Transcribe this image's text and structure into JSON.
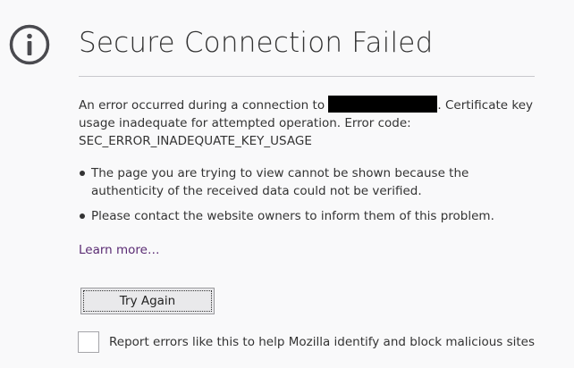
{
  "page": {
    "title": "Secure Connection Failed",
    "icon": "info-icon"
  },
  "description": {
    "before_host": "An error occurred during a connection to ",
    "after_host": ". Certificate key usage inadequate for attempted operation. Error code: ",
    "error_code": "SEC_ERROR_INADEQUATE_KEY_USAGE"
  },
  "bullets": [
    {
      "text": "The page you are trying to view cannot be shown because the authenticity of the received data could not be verified."
    },
    {
      "text": "Please contact the website owners to inform them of this problem."
    }
  ],
  "learn_more": {
    "label": "Learn more…"
  },
  "try_again": {
    "label": "Try Again"
  },
  "report": {
    "label": "Report errors like this to help Mozilla identify and block malicious sites",
    "checked": false
  },
  "colors": {
    "background": "#f9f9fa",
    "text": "#333333",
    "link": "#5a2b73",
    "icon": "#4a4a4f"
  }
}
